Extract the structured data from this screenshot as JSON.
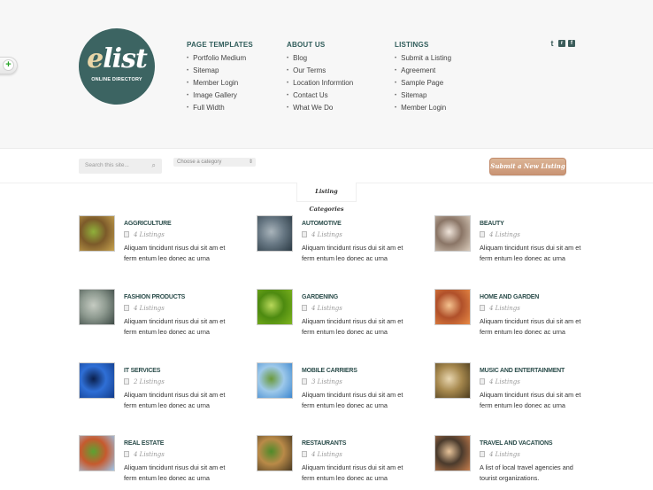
{
  "logo": {
    "name_first": "e",
    "name_rest": "list",
    "tagline": "ONLINE DIRECTORY"
  },
  "nav": [
    {
      "heading": "PAGE TEMPLATES",
      "items": [
        "Portfolio Medium",
        "Sitemap",
        "Member Login",
        "Image Gallery",
        "Full Width"
      ]
    },
    {
      "heading": "ABOUT US",
      "items": [
        "Blog",
        "Our Terms",
        "Location Informtion",
        "Contact Us",
        "What We Do"
      ]
    },
    {
      "heading": "LISTINGS",
      "items": [
        "Submit a Listing",
        "Agreement",
        "Sample Page",
        "Sitemap",
        "Member Login"
      ]
    }
  ],
  "social": {
    "twitter": "t",
    "rss": "r",
    "facebook": "f"
  },
  "toolbar": {
    "search_placeholder": "Search this site...",
    "search_icon": "search-icon",
    "category_select": "Choose a category",
    "submit_label": "Submit a New Listing"
  },
  "tab_label": "Listing Categories",
  "toggle_icon": "+",
  "categories": [
    {
      "title": "AGGRICULTURE",
      "count": "4 Listings",
      "desc": "Aliquam tincidunt risus dui sit am et ferm entum leo donec ac urna",
      "colors": [
        "#c7a34f",
        "#7c5a2a",
        "#8fb03a"
      ]
    },
    {
      "title": "AUTOMOTIVE",
      "count": "4 Listings",
      "desc": "Aliquam tincidunt risus dui sit am et ferm entum leo donec ac urna",
      "colors": [
        "#2b3a44",
        "#687884",
        "#a9b4bb"
      ]
    },
    {
      "title": "BEAUTY",
      "count": "4 Listings",
      "desc": "Aliquam tincidunt risus dui sit am et ferm entum leo donec ac urna",
      "colors": [
        "#d9cbbb",
        "#8a7566",
        "#efe4da"
      ]
    },
    {
      "title": "FASHION PRODUCTS",
      "count": "4 Listings",
      "desc": "Aliquam tincidunt risus dui sit am et ferm entum leo donec ac urna",
      "colors": [
        "#3d4a45",
        "#8e9a90",
        "#c5cbc2"
      ]
    },
    {
      "title": "GARDENING",
      "count": "4 Listings",
      "desc": "Aliquam tincidunt risus dui sit am et ferm entum leo donec ac urna",
      "colors": [
        "#7fb51f",
        "#4d8a10",
        "#b8d85a"
      ]
    },
    {
      "title": "HOME AND GARDEN",
      "count": "4 Listings",
      "desc": "Aliquam tincidunt risus dui sit am et ferm entum leo donec ac urna",
      "colors": [
        "#e98a45",
        "#b0502a",
        "#f4c28f"
      ]
    },
    {
      "title": "IT SERVICES",
      "count": "2 Listings",
      "desc": "Aliquam tincidunt risus dui sit am et ferm entum leo donec ac urna",
      "colors": [
        "#123c8a",
        "#2f6fd6",
        "#0a1f4c"
      ]
    },
    {
      "title": "MOBILE CARRIERS",
      "count": "3 Listings",
      "desc": "Aliquam tincidunt risus dui sit am et ferm entum leo donec ac urna",
      "colors": [
        "#3d87cf",
        "#9ec9ea",
        "#6b9a3a"
      ]
    },
    {
      "title": "MUSIC AND ENTERTAINMENT",
      "count": "4 Listings",
      "desc": "Aliquam tincidunt risus dui sit am et ferm entum leo donec ac urna",
      "colors": [
        "#4a3a1c",
        "#a6884e",
        "#e8d6b0"
      ]
    },
    {
      "title": "REAL ESTATE",
      "count": "4 Listings",
      "desc": "Aliquam tincidunt risus dui sit am et ferm entum leo donec ac urna",
      "colors": [
        "#9cc7ee",
        "#c65a2e",
        "#5aa332"
      ]
    },
    {
      "title": "RESTAURANTS",
      "count": "4 Listings",
      "desc": "Aliquam tincidunt risus dui sit am et ferm entum leo donec ac urna",
      "colors": [
        "#4a3a22",
        "#b98a48",
        "#4f8a2a"
      ]
    },
    {
      "title": "TRAVEL AND VACATIONS",
      "count": "4 Listings",
      "desc": "A list of local travel agencies and tourist organizations.",
      "colors": [
        "#c87e4d",
        "#4a3a2c",
        "#e8c49a"
      ]
    }
  ]
}
